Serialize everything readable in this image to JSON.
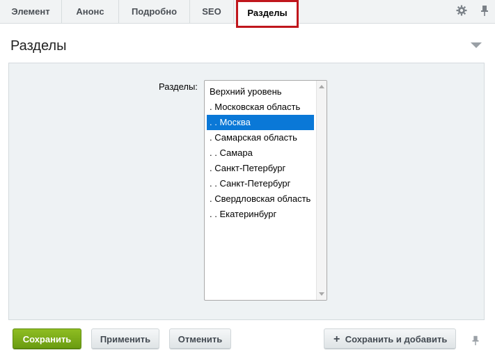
{
  "tabs": [
    {
      "label": "Элемент"
    },
    {
      "label": "Анонс"
    },
    {
      "label": "Подробно"
    },
    {
      "label": "SEO"
    },
    {
      "label": "Разделы"
    }
  ],
  "active_tab": "Разделы",
  "toolbar_icons": [
    "gear-icon",
    "pin-icon"
  ],
  "section": {
    "title": "Разделы"
  },
  "field": {
    "label": "Разделы:",
    "items": [
      "Верхний уровень",
      ". Московская область",
      ". . Москва",
      ". Самарская область",
      ". . Самара",
      ". Санкт-Петербург",
      ". . Санкт-Петербург",
      ". Свердловская область",
      ". . Екатеринбург"
    ],
    "selected": ". . Москва"
  },
  "buttons": {
    "save": "Сохранить",
    "apply": "Применить",
    "cancel": "Отменить",
    "save_add": "Сохранить и добавить"
  },
  "colors": {
    "selection": "#0a78d7",
    "save_button": "#7aaa18",
    "active_tab_border": "#c0161c"
  }
}
